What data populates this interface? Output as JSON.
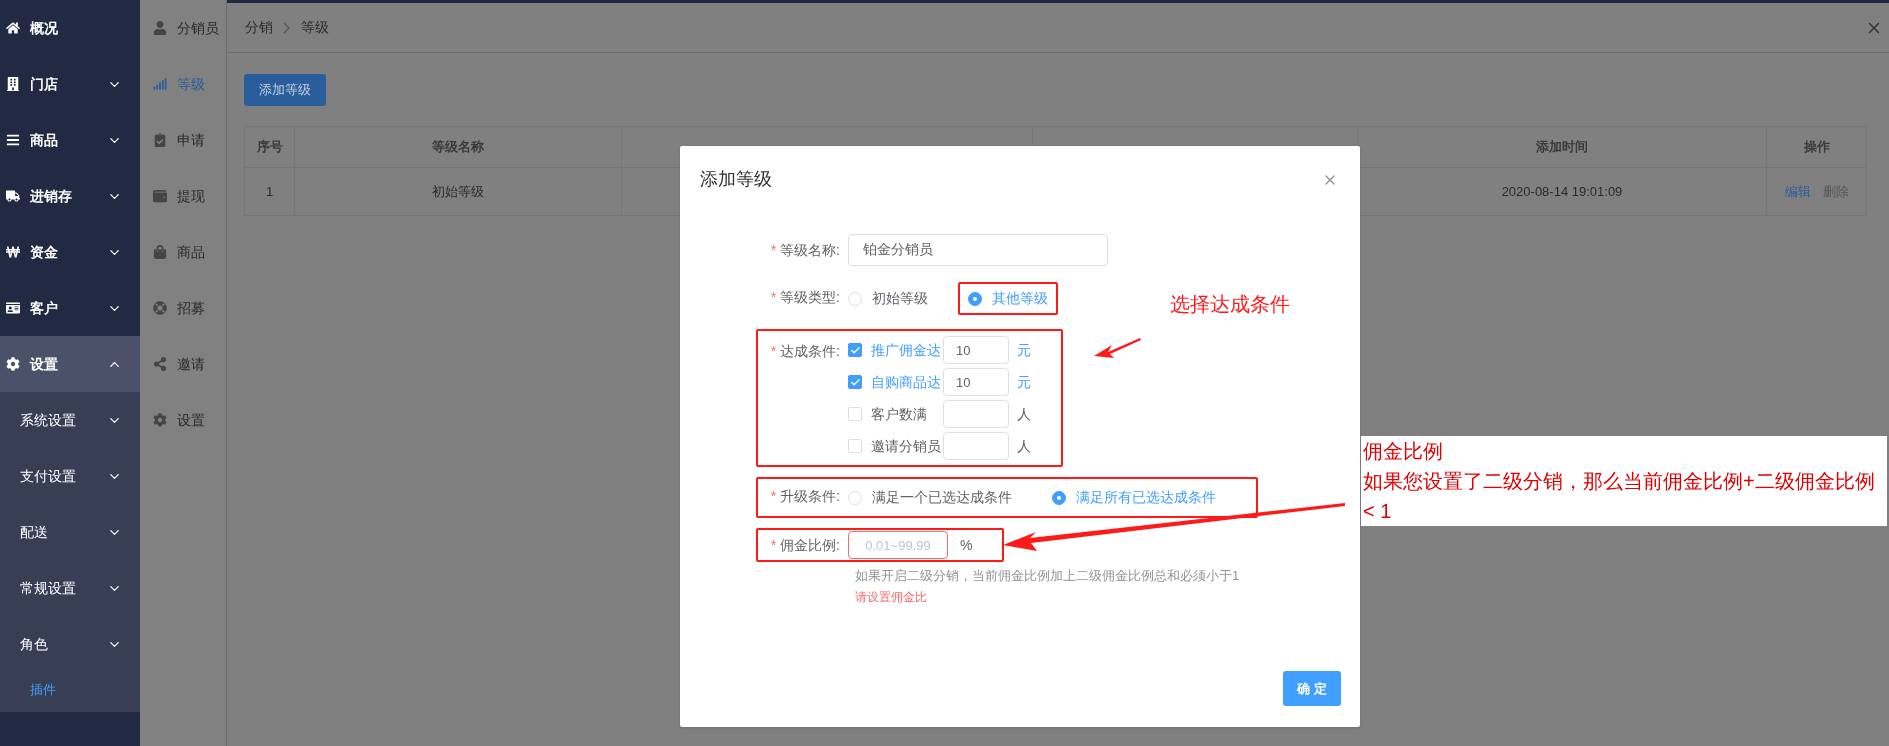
{
  "sidebar": {
    "items": [
      {
        "label": "概况",
        "kind": "link",
        "selected": false
      },
      {
        "label": "门店",
        "kind": "group",
        "expanded": false,
        "selected": false
      },
      {
        "label": "商品",
        "kind": "group",
        "expanded": false,
        "selected": false
      },
      {
        "label": "进销存",
        "kind": "group",
        "expanded": false,
        "selected": false
      },
      {
        "label": "资金",
        "kind": "group",
        "expanded": false,
        "selected": false
      },
      {
        "label": "客户",
        "kind": "group",
        "expanded": false,
        "selected": false
      },
      {
        "label": "设置",
        "kind": "group",
        "expanded": true,
        "selected": true,
        "children": [
          {
            "label": "系统设置",
            "kind": "group",
            "expanded": false,
            "selected": false
          },
          {
            "label": "支付设置",
            "kind": "group",
            "expanded": false,
            "selected": false
          },
          {
            "label": "配送",
            "kind": "group",
            "expanded": false,
            "selected": false
          },
          {
            "label": "常规设置",
            "kind": "group",
            "expanded": false,
            "selected": false
          },
          {
            "label": "角色",
            "kind": "group",
            "expanded": false,
            "selected": false
          },
          {
            "label": "插件",
            "kind": "link",
            "selected": true
          }
        ]
      }
    ]
  },
  "subnav": {
    "items": [
      {
        "label": "分销员",
        "selected": false
      },
      {
        "label": "等级",
        "selected": true
      },
      {
        "label": "申请",
        "selected": false
      },
      {
        "label": "提现",
        "selected": false
      },
      {
        "label": "商品",
        "selected": false
      },
      {
        "label": "招募",
        "selected": false
      },
      {
        "label": "邀请",
        "selected": false
      },
      {
        "label": "设置",
        "selected": false
      }
    ]
  },
  "breadcrumb": [
    "分销",
    "等级"
  ],
  "add_button": "添加等级",
  "table": {
    "columns": [
      "序号",
      "等级名称",
      "添加时间",
      "操作"
    ],
    "rows": [
      {
        "cells": [
          "1",
          "初始等级",
          "2020-08-14 19:01:09"
        ],
        "actions": [
          {
            "label": "编辑",
            "kind": "edit"
          },
          {
            "label": "删除",
            "kind": "delete"
          }
        ]
      }
    ]
  },
  "modal": {
    "title": "添加等级",
    "fields": [
      {
        "kind": "text",
        "label": "等级名称:",
        "asterisk": "*",
        "highlighted": false,
        "value": "铂金分销员"
      },
      {
        "kind": "radio",
        "label": "等级类型:",
        "asterisk": "*",
        "highlighted": false,
        "options": [
          {
            "label": "初始等级",
            "selected": false,
            "highlighted": false
          },
          {
            "label": "其他等级",
            "selected": true,
            "highlighted": true
          }
        ]
      },
      {
        "kind": "conditions",
        "label": "达成条件:",
        "asterisk": "*",
        "highlighted": true,
        "items": [
          {
            "label": "推广佣金达",
            "checked": true,
            "value": "10",
            "unit": "元"
          },
          {
            "label": "自购商品达",
            "checked": true,
            "value": "10",
            "unit": "元"
          },
          {
            "label": "客户数满",
            "checked": false,
            "unit": "人"
          },
          {
            "label": "邀请分销员",
            "checked": false,
            "unit": "人"
          }
        ]
      },
      {
        "kind": "radio",
        "label": "升级条件:",
        "asterisk": "*",
        "highlighted": true,
        "options": [
          {
            "label": "满足一个已选达成条件",
            "selected": false,
            "highlighted": false
          },
          {
            "label": "满足所有已选达成条件",
            "selected": true,
            "highlighted": false
          }
        ]
      },
      {
        "kind": "percent",
        "label": "佣金比例:",
        "asterisk": "*",
        "highlighted": true,
        "placeholder": "0.01~99.99",
        "unit": "%",
        "invalid": true,
        "help": "如果开启二级分销，当前佣金比例加上二级佣金比例总和必须小于1",
        "error": "请设置佣金比"
      }
    ],
    "confirm": "确 定"
  },
  "annotations": [
    {
      "kind": "label",
      "text": "选择达成条件"
    },
    {
      "kind": "note",
      "title": "佣金比例",
      "text": "如果您设置了二级分销，那么当前佣金比例+二级佣金比例 < 1"
    }
  ]
}
